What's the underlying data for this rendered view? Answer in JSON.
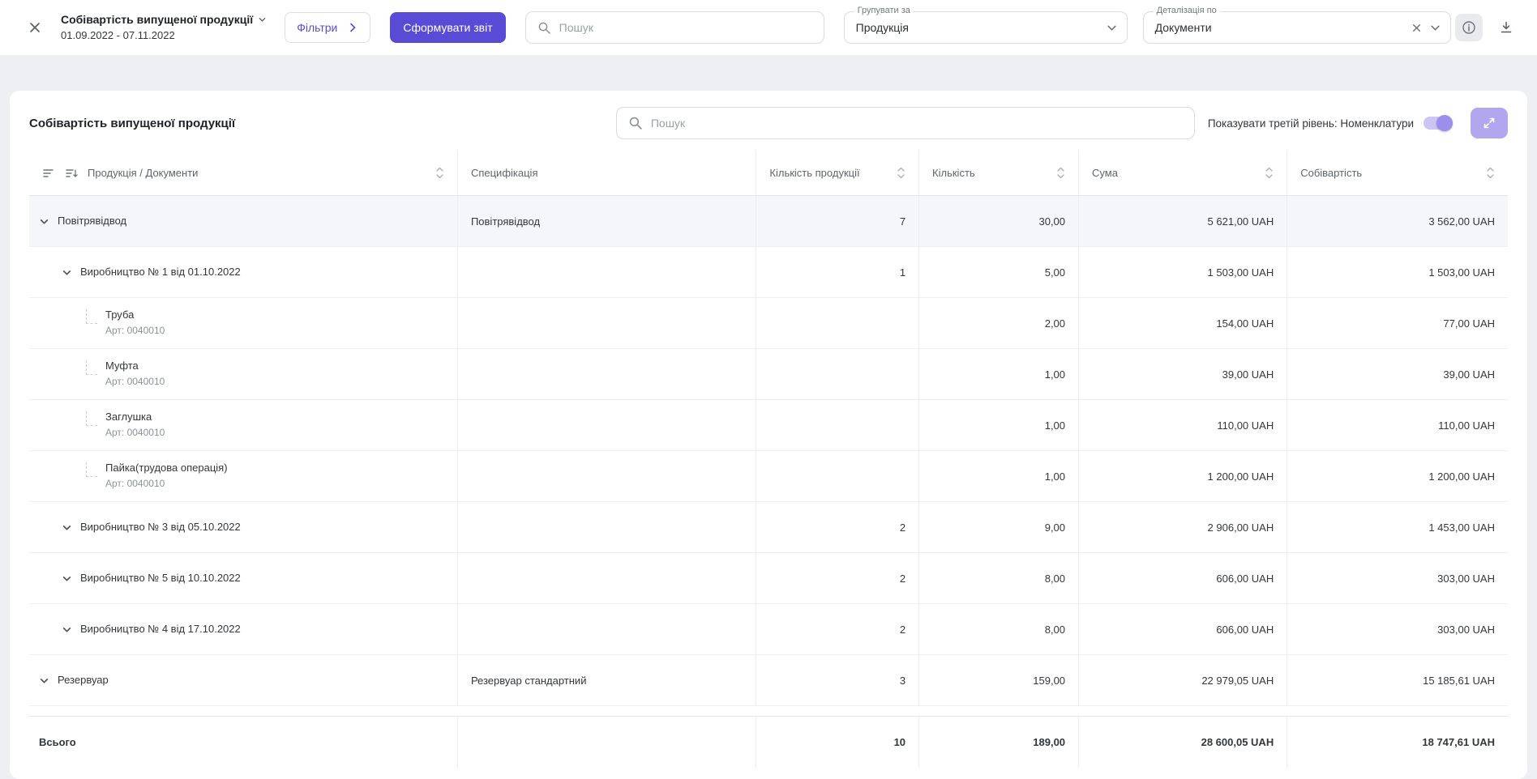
{
  "topbar": {
    "title": "Собівартість випущеної продукції",
    "date_range": "01.09.2022 - 07.11.2022",
    "filters_label": "Фільтри",
    "generate_label": "Сформувати звіт",
    "search_placeholder": "Пошук",
    "group_by": {
      "label": "Групувати за",
      "value": "Продукція"
    },
    "detail_by": {
      "label": "Деталізація по",
      "value": "Документи"
    }
  },
  "panel": {
    "title": "Собівартість випущеної продукції",
    "search_placeholder": "Пошук",
    "toggle_label": "Показувати третій рівень: Номенклатури"
  },
  "colors": {
    "accent": "#5a4bd6",
    "accent_light": "#b2a6ef",
    "row_highlight": "#f5f6f9"
  },
  "table": {
    "columns": [
      "Продукція / Документи",
      "Специфікація",
      "Кількість продукції",
      "Кількість",
      "Сума",
      "Собівартість"
    ],
    "rows": [
      {
        "level": 0,
        "leaf": false,
        "highlight": true,
        "name": "Повітрявідвод",
        "sub": "",
        "spec": "Повітрявідвод",
        "qty_prod": "7",
        "qty": "30,00",
        "sum": "5 621,00 UAH",
        "cost": "3 562,00 UAH"
      },
      {
        "level": 1,
        "leaf": false,
        "highlight": false,
        "name": "Виробництво № 1 від 01.10.2022",
        "sub": "",
        "spec": "",
        "qty_prod": "1",
        "qty": "5,00",
        "sum": "1 503,00 UAH",
        "cost": "1 503,00 UAH"
      },
      {
        "level": 2,
        "leaf": true,
        "highlight": false,
        "name": "Труба",
        "sub": "Арт: 0040010",
        "spec": "",
        "qty_prod": "",
        "qty": "2,00",
        "sum": "154,00 UAH",
        "cost": "77,00 UAH"
      },
      {
        "level": 2,
        "leaf": true,
        "highlight": false,
        "name": "Муфта",
        "sub": "Арт: 0040010",
        "spec": "",
        "qty_prod": "",
        "qty": "1,00",
        "sum": "39,00 UAH",
        "cost": "39,00 UAH"
      },
      {
        "level": 2,
        "leaf": true,
        "highlight": false,
        "name": "Заглушка",
        "sub": "Арт: 0040010",
        "spec": "",
        "qty_prod": "",
        "qty": "1,00",
        "sum": "110,00 UAH",
        "cost": "110,00 UAH"
      },
      {
        "level": 2,
        "leaf": true,
        "highlight": false,
        "name": "Пайка(трудова операція)",
        "sub": "Арт: 0040010",
        "spec": "",
        "qty_prod": "",
        "qty": "1,00",
        "sum": "1 200,00 UAH",
        "cost": "1 200,00 UAH"
      },
      {
        "level": 1,
        "leaf": false,
        "highlight": false,
        "name": "Виробництво № 3 від 05.10.2022",
        "sub": "",
        "spec": "",
        "qty_prod": "2",
        "qty": "9,00",
        "sum": "2 906,00 UAH",
        "cost": "1 453,00 UAH"
      },
      {
        "level": 1,
        "leaf": false,
        "highlight": false,
        "name": "Виробництво № 5 від 10.10.2022",
        "sub": "",
        "spec": "",
        "qty_prod": "2",
        "qty": "8,00",
        "sum": "606,00 UAH",
        "cost": "303,00 UAH"
      },
      {
        "level": 1,
        "leaf": false,
        "highlight": false,
        "name": "Виробництво № 4 від 17.10.2022",
        "sub": "",
        "spec": "",
        "qty_prod": "2",
        "qty": "8,00",
        "sum": "606,00 UAH",
        "cost": "303,00 UAH"
      },
      {
        "level": 0,
        "leaf": false,
        "highlight": false,
        "name": "Резервуар",
        "sub": "",
        "spec": "Резервуар стандартний",
        "qty_prod": "3",
        "qty": "159,00",
        "sum": "22 979,05 UAH",
        "cost": "15 185,61 UAH"
      }
    ],
    "total": {
      "label": "Всього",
      "spec": "",
      "qty_prod": "10",
      "qty": "189,00",
      "sum": "28 600,05 UAH",
      "cost": "18 747,61 UAH"
    }
  }
}
